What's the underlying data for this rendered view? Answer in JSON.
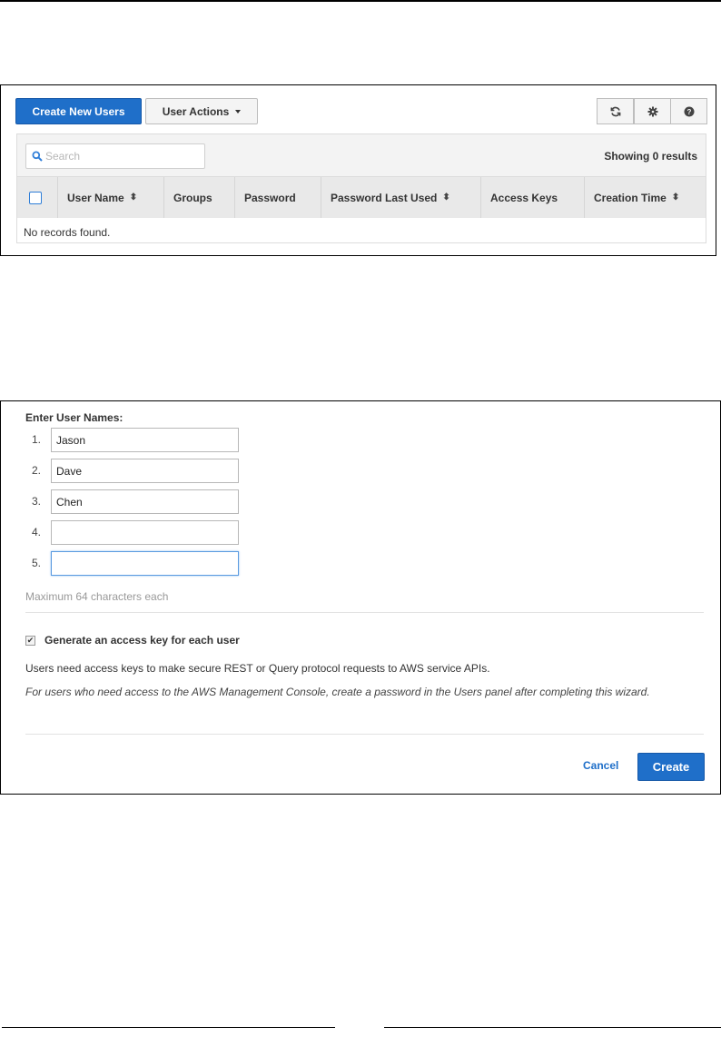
{
  "users_panel": {
    "create_button": "Create New Users",
    "actions_button": "User Actions",
    "toolbar_icons": [
      "refresh-icon",
      "gear-icon",
      "help-icon"
    ],
    "search": {
      "placeholder": "Search",
      "value": ""
    },
    "results_text": "Showing 0 results",
    "columns": [
      "User Name",
      "Groups",
      "Password",
      "Password Last Used",
      "Access Keys",
      "Creation Time"
    ],
    "empty_text": "No records found."
  },
  "create_users_dialog": {
    "label": "Enter User Names:",
    "names": [
      {
        "number": "1.",
        "value": "Jason"
      },
      {
        "number": "2.",
        "value": "Dave"
      },
      {
        "number": "3.",
        "value": "Chen"
      },
      {
        "number": "4.",
        "value": ""
      },
      {
        "number": "5.",
        "value": ""
      }
    ],
    "hint": "Maximum 64 characters each",
    "generate_key": {
      "label": "Generate an access key for each user",
      "checked": true
    },
    "info_text": "Users need access keys to make secure REST or Query protocol requests to AWS service APIs.",
    "info_italic": "For users who need access to the AWS Management Console, create a password in the Users panel after completing this wizard.",
    "cancel_label": "Cancel",
    "create_label": "Create"
  },
  "colors": {
    "primary": "#1f6fc9",
    "link": "#1f6fc9"
  }
}
